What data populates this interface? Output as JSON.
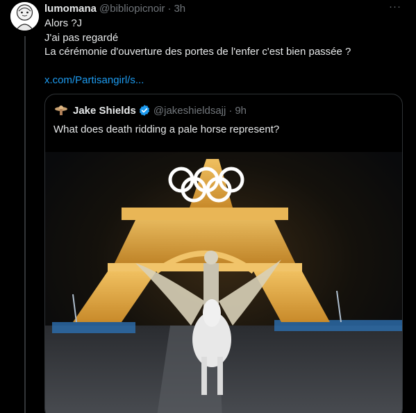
{
  "post": {
    "author_name": "lumomana",
    "author_handle": "@bibliopicnoir",
    "separator": "·",
    "time": "3h",
    "text_lines": [
      "Alors ?J",
      "J'ai pas regardé",
      "La cérémonie d'ouverture des portes de l'enfer c'est bien passée ?"
    ],
    "link_text": "x.com/Partisangirl/s...",
    "more_label": "···"
  },
  "quote": {
    "author_name": "Jake Shields",
    "author_handle": "@jakeshieldsajj",
    "separator": "·",
    "time": "9h",
    "text": "What does death ridding a pale horse represent?",
    "verified_color": "#1d9bf0"
  },
  "colors": {
    "background": "#000000",
    "text": "#e7e9ea",
    "secondary": "#71767b",
    "link": "#1d9bf0",
    "border": "#2f3336"
  }
}
